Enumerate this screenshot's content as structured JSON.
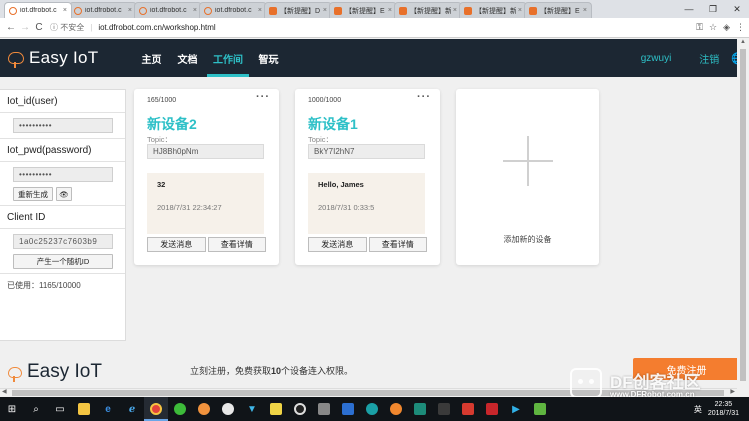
{
  "browser": {
    "tabs": [
      {
        "label": "iot.dfrobot.c",
        "favicon": "iot-cloud",
        "active": true
      },
      {
        "label": "iot.dfrobot.c",
        "favicon": "iot-cloud",
        "active": false
      },
      {
        "label": "iot.dfrobot.c",
        "favicon": "iot-cloud",
        "active": false
      },
      {
        "label": "iot.dfrobot.c",
        "favicon": "iot-cloud",
        "active": false
      },
      {
        "label": "【新提醒】D",
        "favicon": "dfrobot",
        "active": false
      },
      {
        "label": "【新提醒】E",
        "favicon": "dfrobot",
        "active": false
      },
      {
        "label": "【新提醒】新",
        "favicon": "dfrobot",
        "active": false
      },
      {
        "label": "【新提醒】新",
        "favicon": "dfrobot",
        "active": false
      },
      {
        "label": "【新提醒】E",
        "favicon": "dfrobot",
        "active": false
      }
    ],
    "tab_close": "×",
    "window_controls": {
      "minimize": "—",
      "maximize": "❐",
      "close": "✕"
    },
    "nav": {
      "back": "←",
      "forward": "→",
      "reload": "C"
    },
    "security_label": "ⓘ 不安全",
    "url": "iot.dfrobot.com.cn/workshop.html",
    "addr_icons": [
      "key-icon",
      "star-icon",
      "extension-icon",
      "menu-icon"
    ]
  },
  "header": {
    "logo_text": "Easy IoT",
    "nav": [
      {
        "label": "主页",
        "active": false
      },
      {
        "label": "文档",
        "active": false
      },
      {
        "label": "工作间",
        "active": true
      },
      {
        "label": "智玩",
        "active": false
      }
    ],
    "username": "gzwuyi",
    "logout_label": "注销",
    "accent_color": "#2ec0c7"
  },
  "sidebar": {
    "iot_id_title": "Iot_id(user)",
    "iot_id_value": "••••••••••",
    "iot_pwd_title": "Iot_pwd(password)",
    "iot_pwd_value": "••••••••••",
    "regenerate_label": "重新生成",
    "eye_glyph": "👁",
    "client_id_title": "Client ID",
    "client_id_value": "1a0c25237c7603b9",
    "random_id_label": "产生一个随机ID",
    "used_text": "已使用：1165/10000"
  },
  "devices": [
    {
      "count": "165/1000",
      "name": "新设备2",
      "topic_label": "Topic：",
      "topic": "HJ8Bh0pNm",
      "message": "32",
      "time": "2018/7/31 22:34:27",
      "send_label": "发送消息",
      "detail_label": "查看详情"
    },
    {
      "count": "1000/1000",
      "name": "新设备1",
      "topic_label": "Topic：",
      "topic": "BkY7I2hN7",
      "message": "Hello, James",
      "time": "2018/7/31 0:33:5",
      "send_label": "发送消息",
      "detail_label": "查看详情"
    }
  ],
  "more_glyph": "···",
  "add_device_label": "添加新的设备",
  "footer": {
    "logo_text": "Easy IoT",
    "promo_pre": "立刻注册，免费获取",
    "promo_num": "10",
    "promo_post": "个设备连入权限。",
    "promo_button": "免费注册"
  },
  "watermark": {
    "big": "DF创客社区",
    "small": "www.DFRobot.com.cn"
  },
  "taskbar": {
    "ime": "英",
    "time": "22:35",
    "date": "2018/7/31"
  }
}
